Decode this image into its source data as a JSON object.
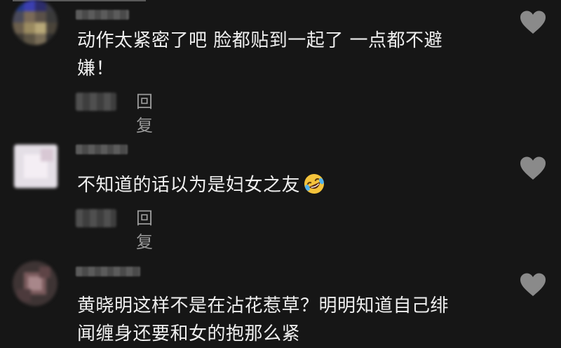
{
  "comments": [
    {
      "text_line1": "动作太紧密了吧 脸都贴到一起了 一点都不避",
      "text_line2": "嫌！",
      "reply_label": "回复",
      "like_icon": "heart-icon"
    },
    {
      "text_line1": "不知道的话以为是妇女之友",
      "emoji": "rolling-on-floor-laughing-emoji",
      "reply_label": "回复",
      "like_icon": "heart-icon"
    },
    {
      "text_line1": "黄晓明这样不是在沾花惹草？明明知道自己绯",
      "text_line2": "闻缠身还要和女的抱那么紧",
      "like_icon": "heart-icon"
    }
  ],
  "colors": {
    "background": "#161616",
    "text": "#efefef",
    "secondary_text": "#9a9a9a",
    "icon": "#8a8a8a"
  }
}
